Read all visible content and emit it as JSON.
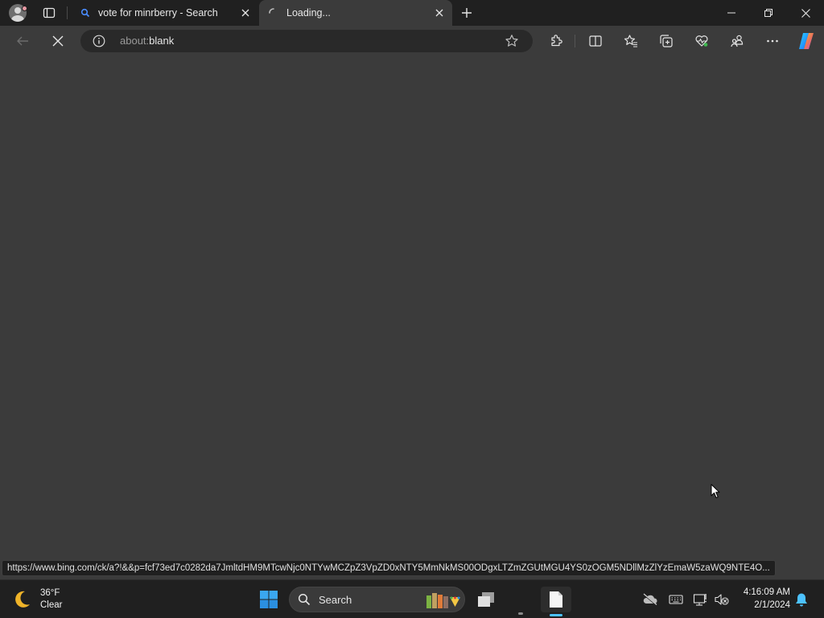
{
  "browser": {
    "tabs": [
      {
        "title": "vote for minrberry - Search",
        "icon": "bing-search-icon",
        "active": false
      },
      {
        "title": "Loading...",
        "icon": "loading-spinner-icon",
        "active": true
      }
    ],
    "address": {
      "scheme": "about:",
      "path": "blank"
    }
  },
  "status_url": "https://www.bing.com/ck/a?!&&p=fcf73ed7c0282da7JmltdHM9MTcwNjc0NTYwMCZpZ3VpZD0xNTY5MmNkMS00ODgxLTZmZGUtMGU4YS0zOGM5NDllMzZlYzEmaW5zaWQ9NTE4O...",
  "taskbar": {
    "weather": {
      "temp": "36°F",
      "condition": "Clear"
    },
    "search_label": "Search",
    "clock": {
      "time": "4:16:09 AM",
      "date": "2/1/2024"
    }
  },
  "colors": {
    "accent": "#4cc2ff",
    "content_bg": "#3b3b3b",
    "chrome_bg": "#202020"
  }
}
